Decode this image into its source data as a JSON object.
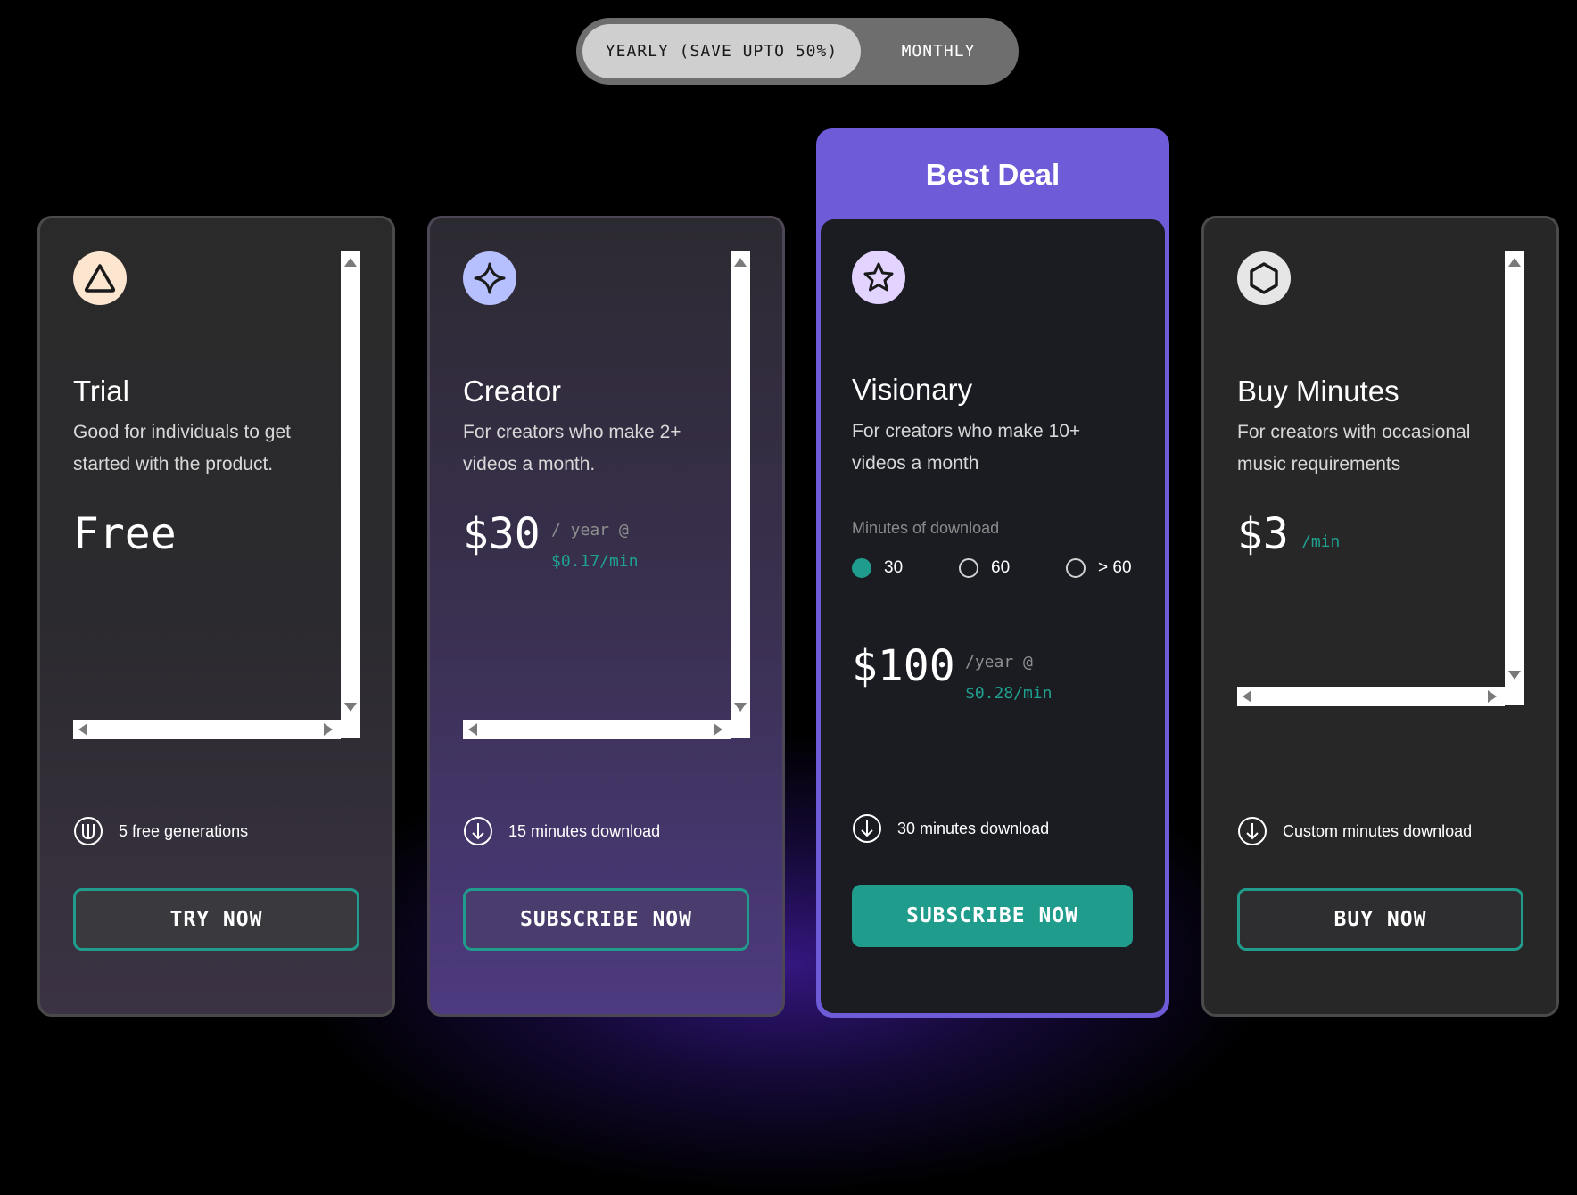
{
  "billing_toggle": {
    "yearly_label": "YEARLY (SAVE UPTO 50%)",
    "monthly_label": "MONTHLY",
    "selected": "yearly"
  },
  "plans": [
    {
      "title": "Trial",
      "description": "Good for individuals to get started with the product.",
      "price": "Free",
      "feature": "5 free generations",
      "cta": "TRY NOW",
      "icon": "triangle-icon"
    },
    {
      "title": "Creator",
      "description": "For creators who make 2+ videos a month.",
      "price": "$30",
      "period": "/ year @",
      "rate": "$0.17/min",
      "feature": "15 minutes download",
      "cta": "SUBSCRIBE NOW",
      "icon": "sparkle-icon"
    },
    {
      "badge": "Best Deal",
      "title": "Visionary",
      "description": "For creators who make 10+ videos a month",
      "minutes_label": "Minutes of download",
      "minute_options": [
        "30",
        "60",
        "> 60"
      ],
      "selected_option": "30",
      "price": "$100",
      "period": "/year @",
      "rate": "$0.28/min",
      "feature": "30 minutes download",
      "cta": "SUBSCRIBE NOW",
      "icon": "star-icon"
    },
    {
      "title": "Buy Minutes",
      "description": "For creators with occasional music requirements",
      "price": "$3",
      "rate": "/min",
      "feature": "Custom minutes download",
      "cta": "BUY NOW",
      "icon": "hexagon-icon"
    }
  ],
  "colors": {
    "accent": "#1f9c8c",
    "featured": "#6d5bd8",
    "background": "#000000"
  }
}
